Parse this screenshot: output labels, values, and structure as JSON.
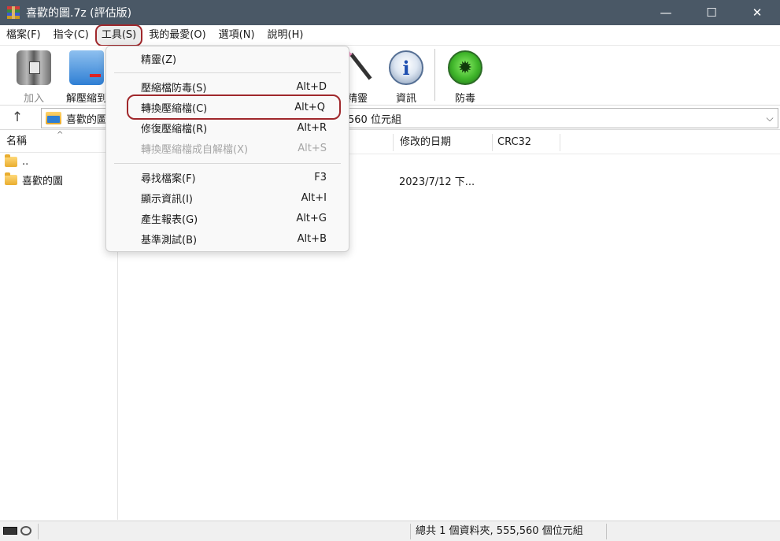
{
  "window": {
    "title": "喜歡的圖.7z (評估版)",
    "minimize_glyph": "—",
    "maximize_glyph": "☐",
    "close_glyph": "✕"
  },
  "menubar": {
    "items": [
      {
        "label": "檔案(F)"
      },
      {
        "label": "指令(C)"
      },
      {
        "label": "工具(S)"
      },
      {
        "label": "我的最愛(O)"
      },
      {
        "label": "選項(N)"
      },
      {
        "label": "說明(H)"
      }
    ]
  },
  "toolbar": {
    "add_label": "加入",
    "extract_label": "解壓縮到",
    "wizard_label": "精靈",
    "info_label": "資訊",
    "virus_label": "防毒",
    "icons": {
      "add": "archive-icon",
      "extract": "folder-extract-icon",
      "wizard": "wizard-wand-icon",
      "info": "info-icon",
      "virus": "bug-scan-icon"
    }
  },
  "address": {
    "up_glyph": "↑",
    "path_left": "喜歡的圖",
    "path_right": "560 位元組",
    "dropdown_glyph": "⌵"
  },
  "left_pane": {
    "header": "名稱",
    "sort_glyph": "^",
    "rows": [
      {
        "label": ".."
      },
      {
        "label": "喜歡的圖"
      }
    ]
  },
  "file_list": {
    "columns": [
      "修改的日期",
      "CRC32"
    ],
    "rows": [
      {
        "modified": "2023/7/12 下..."
      }
    ]
  },
  "tools_menu": {
    "items": [
      {
        "label": "精靈(Z)",
        "shortcut": ""
      },
      {
        "label": "壓縮檔防毒(S)",
        "shortcut": "Alt+D"
      },
      {
        "label": "轉換壓縮檔(C)",
        "shortcut": "Alt+Q"
      },
      {
        "label": "修復壓縮檔(R)",
        "shortcut": "Alt+R"
      },
      {
        "label": "轉換壓縮檔成自解檔(X)",
        "shortcut": "Alt+S"
      },
      {
        "label": "尋找檔案(F)",
        "shortcut": "F3"
      },
      {
        "label": "顯示資訊(I)",
        "shortcut": "Alt+I"
      },
      {
        "label": "產生報表(G)",
        "shortcut": "Alt+G"
      },
      {
        "label": "基準測試(B)",
        "shortcut": "Alt+B"
      }
    ]
  },
  "status": {
    "summary": "總共 1 個資料夾, 555,560 個位元組"
  },
  "colors": {
    "titlebar": "#4a5866",
    "highlight_box": "#a0282c",
    "disabled_text": "#a6a6a6"
  }
}
